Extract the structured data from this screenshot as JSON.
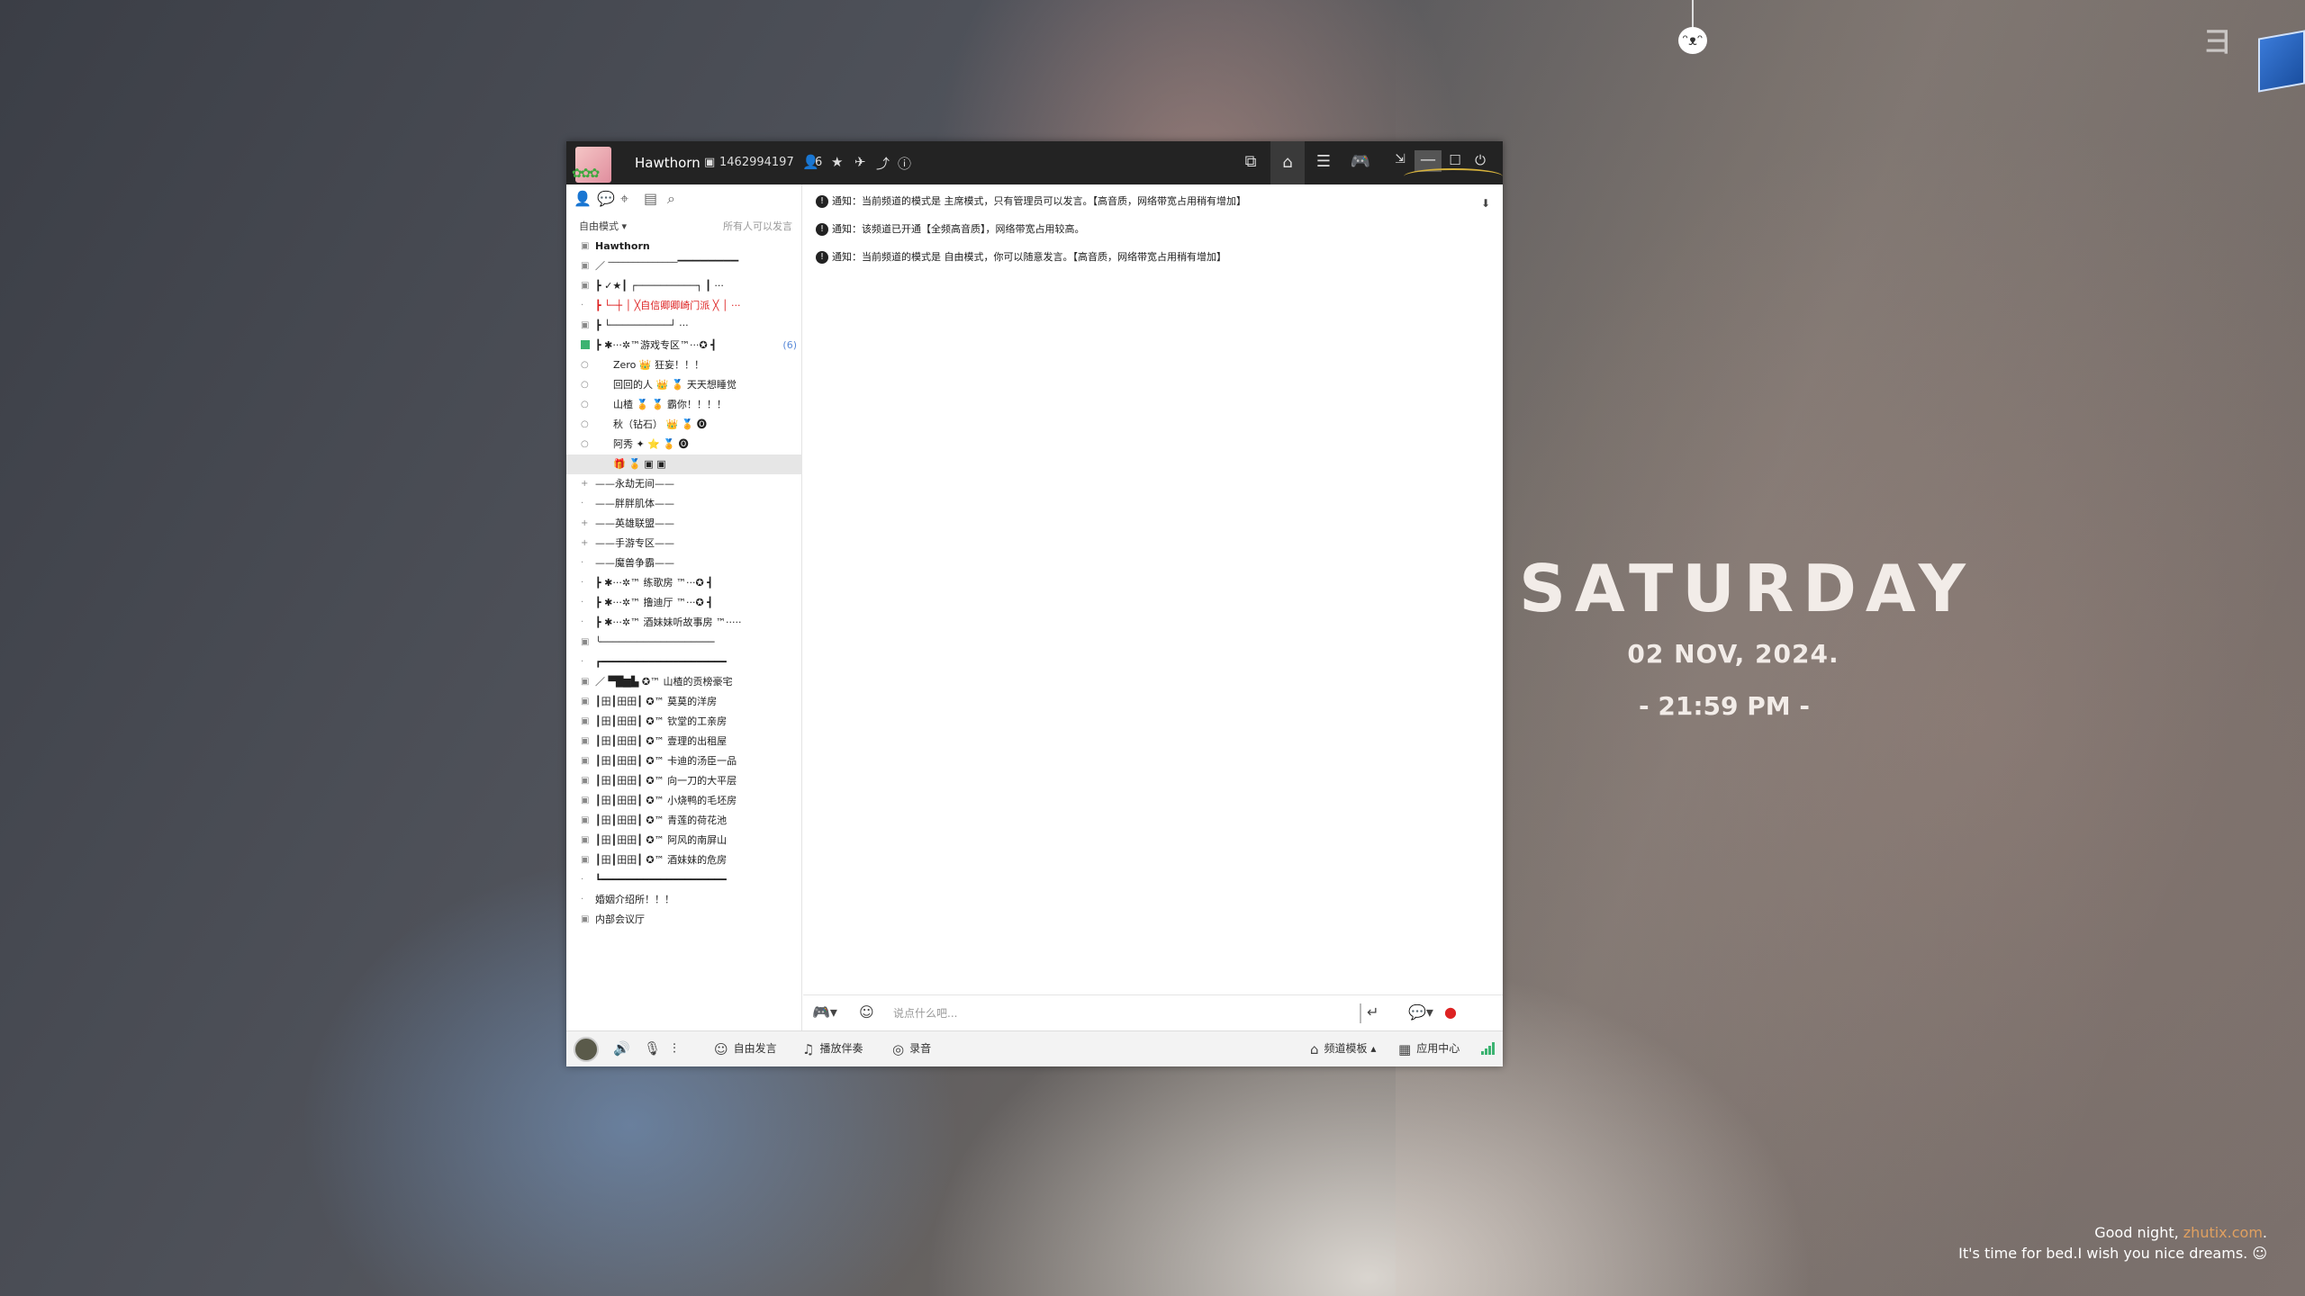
{
  "window": {
    "username": "Hawthorn",
    "user_id": "1462994197",
    "online_count": "6"
  },
  "left_panel": {
    "mode": "自由模式 ▾",
    "mode_hint": "所有人可以发言",
    "tree": [
      {
        "text": "Hawthorn",
        "level": 1,
        "exp": "▣",
        "style": "bold"
      },
      {
        "text": "／ ‾‾‾‾‾‾‾‾‾‾‾‾‾‾▔▔▔▔▔▔▔▔",
        "level": 1,
        "exp": "▣"
      },
      {
        "text": "┣  ✓★┃  ┌──────────┐   ┃ ···",
        "level": 1,
        "exp": "▣"
      },
      {
        "text": "┣  └─┼  │ ╳自信卿卿崎门派 ╳ │ ···",
        "level": 1,
        "exp": "·",
        "style": "red"
      },
      {
        "text": "┣         └──────────┘    ···",
        "level": 1,
        "exp": "▣"
      },
      {
        "text": "┣  ✱···✲™游戏专区™···✪    ┫",
        "level": 1,
        "exp": "▣",
        "count": "(6)",
        "expanded": true
      },
      {
        "text": "Zero 👑 狂妄！！！",
        "level": 2,
        "exp": "○"
      },
      {
        "text": "回回的人 👑 🏅 天天想睡觉",
        "level": 2,
        "exp": "○"
      },
      {
        "text": "山楂 🏅 🏅 霸你！！！！",
        "level": 2,
        "exp": "○"
      },
      {
        "text": "秋（钻石） 👑 🏅 🅞",
        "level": 2,
        "exp": "○"
      },
      {
        "text": "阿秀  ✦  ⭐ 🏅 🅞",
        "level": 2,
        "exp": "○"
      },
      {
        "text": "🎁 🏅 ▣ ▣",
        "level": 2,
        "exp": "",
        "selected": true
      },
      {
        "text": "——永劫无间——",
        "level": 1,
        "exp": "+"
      },
      {
        "text": "——胖胖肌体——",
        "level": 1,
        "exp": "·"
      },
      {
        "text": "——英雄联盟——",
        "level": 1,
        "exp": "+"
      },
      {
        "text": "——手游专区——",
        "level": 1,
        "exp": "+"
      },
      {
        "text": "——魔兽争霸——",
        "level": 1,
        "exp": "·"
      },
      {
        "text": "┣  ✱···✲™ 练歌房 ™···✪   ┫",
        "level": 1,
        "exp": "·"
      },
      {
        "text": "┣  ✱···✲™ 撸迪厅 ™···✪   ┫",
        "level": 1,
        "exp": "·"
      },
      {
        "text": "┣  ✱···✲™ 酒妹妹听故事房 ™·····",
        "level": 1,
        "exp": "·"
      },
      {
        "text": "╰───────────────────",
        "level": 1,
        "exp": "▣"
      },
      {
        "text": "┏━━━━━━━━━━━━━━━━━━━━━",
        "level": 1,
        "exp": "·"
      },
      {
        "text": "／ ▀█▆▙      ✪™ 山楂的贡榜豪宅",
        "level": 1,
        "exp": "▣"
      },
      {
        "text": "┃田┃田田┃   ✪™ 莫莫的洋房",
        "level": 1,
        "exp": "▣"
      },
      {
        "text": "┃田┃田田┃   ✪™ 钦堂的工亲房",
        "level": 1,
        "exp": "▣"
      },
      {
        "text": "┃田┃田田┃   ✪™ 壹理的出租屋",
        "level": 1,
        "exp": "▣"
      },
      {
        "text": "┃田┃田田┃   ✪™ 卡迪的汤臣一品",
        "level": 1,
        "exp": "▣"
      },
      {
        "text": "┃田┃田田┃   ✪™ 向一刀的大平层",
        "level": 1,
        "exp": "▣"
      },
      {
        "text": "┃田┃田田┃   ✪™ 小烧鸭的毛坯房",
        "level": 1,
        "exp": "▣"
      },
      {
        "text": "┃田┃田田┃   ✪™ 青莲的荷花池",
        "level": 1,
        "exp": "▣"
      },
      {
        "text": "┃田┃田田┃   ✪™ 阿风的南屏山",
        "level": 1,
        "exp": "▣"
      },
      {
        "text": "┃田┃田田┃   ✪™ 酒妹妹的危房",
        "level": 1,
        "exp": "▣"
      },
      {
        "text": "┗━━━━━━━━━━━━━━━━━━━━━",
        "level": 1,
        "exp": "·"
      },
      {
        "text": "婚姻介绍所！！！",
        "level": 1,
        "exp": "·"
      },
      {
        "text": "内部会议厅",
        "level": 1,
        "exp": "▣"
      }
    ]
  },
  "chat": {
    "messages": [
      "通知：当前频道的模式是 主席模式，只有管理员可以发言。【高音质，网络带宽占用稍有增加】",
      "通知：该频道已开通【全频高音质】，网络带宽占用较高。",
      "通知：当前频道的模式是 自由模式，你可以随意发言。【高音质，网络带宽占用稍有增加】"
    ],
    "input_placeholder": "说点什么吧..."
  },
  "bottom_bar": {
    "free_speech": "自由发言",
    "play_music": "播放伴奏",
    "record": "录音",
    "channel_template": "频道模板 ▴",
    "app_center": "应用中心"
  },
  "wallpaper": {
    "day": "SATURDAY",
    "date": "02 NOV, 2024.",
    "time": "- 21:59 PM -",
    "night_line1_a": "Good night, ",
    "night_line1_link": "zhutix.com",
    "night_line1_b": ".",
    "night_line2": "It's time for bed.I wish you nice dreams. ☺"
  },
  "colors": {
    "titlebar": "#232323",
    "accent_red": "#dd2222",
    "signal_green": "#3cb371",
    "count_blue": "#5a8ad8"
  }
}
